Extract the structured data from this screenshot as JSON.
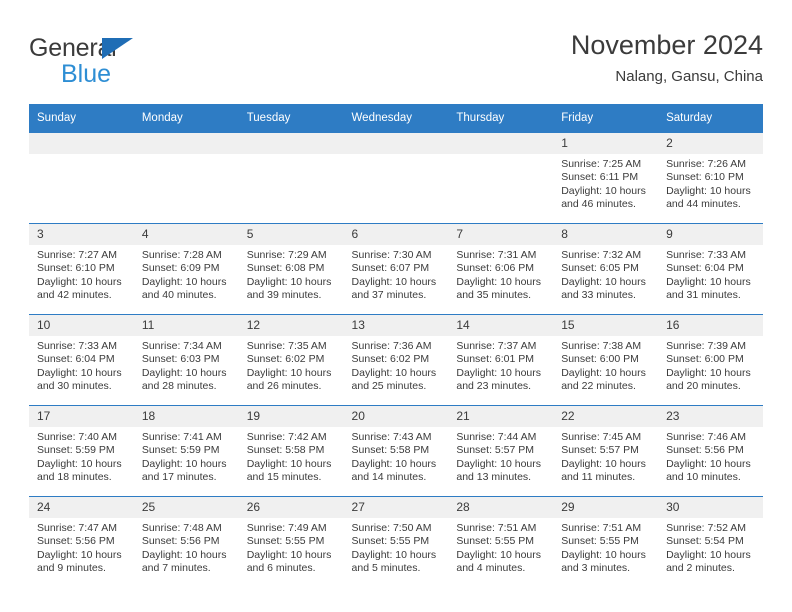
{
  "brand": {
    "name_part1": "General",
    "name_part2": "Blue",
    "triangle_color": "#1f6db5",
    "blue_text_color": "#2e8ed4"
  },
  "header": {
    "title": "November 2024",
    "subtitle": "Nalang, Gansu, China"
  },
  "theme": {
    "header_bg": "#2e7cc4",
    "daynum_bg": "#f0f0f0",
    "text_color": "#3b3b3b"
  },
  "calendar": {
    "weekday_headers": [
      "Sunday",
      "Monday",
      "Tuesday",
      "Wednesday",
      "Thursday",
      "Friday",
      "Saturday"
    ],
    "weeks": [
      [
        {
          "day": "",
          "empty": true
        },
        {
          "day": "",
          "empty": true
        },
        {
          "day": "",
          "empty": true
        },
        {
          "day": "",
          "empty": true
        },
        {
          "day": "",
          "empty": true
        },
        {
          "day": "1",
          "sunrise": "Sunrise: 7:25 AM",
          "sunset": "Sunset: 6:11 PM",
          "daylight": "Daylight: 10 hours and 46 minutes."
        },
        {
          "day": "2",
          "sunrise": "Sunrise: 7:26 AM",
          "sunset": "Sunset: 6:10 PM",
          "daylight": "Daylight: 10 hours and 44 minutes."
        }
      ],
      [
        {
          "day": "3",
          "sunrise": "Sunrise: 7:27 AM",
          "sunset": "Sunset: 6:10 PM",
          "daylight": "Daylight: 10 hours and 42 minutes."
        },
        {
          "day": "4",
          "sunrise": "Sunrise: 7:28 AM",
          "sunset": "Sunset: 6:09 PM",
          "daylight": "Daylight: 10 hours and 40 minutes."
        },
        {
          "day": "5",
          "sunrise": "Sunrise: 7:29 AM",
          "sunset": "Sunset: 6:08 PM",
          "daylight": "Daylight: 10 hours and 39 minutes."
        },
        {
          "day": "6",
          "sunrise": "Sunrise: 7:30 AM",
          "sunset": "Sunset: 6:07 PM",
          "daylight": "Daylight: 10 hours and 37 minutes."
        },
        {
          "day": "7",
          "sunrise": "Sunrise: 7:31 AM",
          "sunset": "Sunset: 6:06 PM",
          "daylight": "Daylight: 10 hours and 35 minutes."
        },
        {
          "day": "8",
          "sunrise": "Sunrise: 7:32 AM",
          "sunset": "Sunset: 6:05 PM",
          "daylight": "Daylight: 10 hours and 33 minutes."
        },
        {
          "day": "9",
          "sunrise": "Sunrise: 7:33 AM",
          "sunset": "Sunset: 6:04 PM",
          "daylight": "Daylight: 10 hours and 31 minutes."
        }
      ],
      [
        {
          "day": "10",
          "sunrise": "Sunrise: 7:33 AM",
          "sunset": "Sunset: 6:04 PM",
          "daylight": "Daylight: 10 hours and 30 minutes."
        },
        {
          "day": "11",
          "sunrise": "Sunrise: 7:34 AM",
          "sunset": "Sunset: 6:03 PM",
          "daylight": "Daylight: 10 hours and 28 minutes."
        },
        {
          "day": "12",
          "sunrise": "Sunrise: 7:35 AM",
          "sunset": "Sunset: 6:02 PM",
          "daylight": "Daylight: 10 hours and 26 minutes."
        },
        {
          "day": "13",
          "sunrise": "Sunrise: 7:36 AM",
          "sunset": "Sunset: 6:02 PM",
          "daylight": "Daylight: 10 hours and 25 minutes."
        },
        {
          "day": "14",
          "sunrise": "Sunrise: 7:37 AM",
          "sunset": "Sunset: 6:01 PM",
          "daylight": "Daylight: 10 hours and 23 minutes."
        },
        {
          "day": "15",
          "sunrise": "Sunrise: 7:38 AM",
          "sunset": "Sunset: 6:00 PM",
          "daylight": "Daylight: 10 hours and 22 minutes."
        },
        {
          "day": "16",
          "sunrise": "Sunrise: 7:39 AM",
          "sunset": "Sunset: 6:00 PM",
          "daylight": "Daylight: 10 hours and 20 minutes."
        }
      ],
      [
        {
          "day": "17",
          "sunrise": "Sunrise: 7:40 AM",
          "sunset": "Sunset: 5:59 PM",
          "daylight": "Daylight: 10 hours and 18 minutes."
        },
        {
          "day": "18",
          "sunrise": "Sunrise: 7:41 AM",
          "sunset": "Sunset: 5:59 PM",
          "daylight": "Daylight: 10 hours and 17 minutes."
        },
        {
          "day": "19",
          "sunrise": "Sunrise: 7:42 AM",
          "sunset": "Sunset: 5:58 PM",
          "daylight": "Daylight: 10 hours and 15 minutes."
        },
        {
          "day": "20",
          "sunrise": "Sunrise: 7:43 AM",
          "sunset": "Sunset: 5:58 PM",
          "daylight": "Daylight: 10 hours and 14 minutes."
        },
        {
          "day": "21",
          "sunrise": "Sunrise: 7:44 AM",
          "sunset": "Sunset: 5:57 PM",
          "daylight": "Daylight: 10 hours and 13 minutes."
        },
        {
          "day": "22",
          "sunrise": "Sunrise: 7:45 AM",
          "sunset": "Sunset: 5:57 PM",
          "daylight": "Daylight: 10 hours and 11 minutes."
        },
        {
          "day": "23",
          "sunrise": "Sunrise: 7:46 AM",
          "sunset": "Sunset: 5:56 PM",
          "daylight": "Daylight: 10 hours and 10 minutes."
        }
      ],
      [
        {
          "day": "24",
          "sunrise": "Sunrise: 7:47 AM",
          "sunset": "Sunset: 5:56 PM",
          "daylight": "Daylight: 10 hours and 9 minutes."
        },
        {
          "day": "25",
          "sunrise": "Sunrise: 7:48 AM",
          "sunset": "Sunset: 5:56 PM",
          "daylight": "Daylight: 10 hours and 7 minutes."
        },
        {
          "day": "26",
          "sunrise": "Sunrise: 7:49 AM",
          "sunset": "Sunset: 5:55 PM",
          "daylight": "Daylight: 10 hours and 6 minutes."
        },
        {
          "day": "27",
          "sunrise": "Sunrise: 7:50 AM",
          "sunset": "Sunset: 5:55 PM",
          "daylight": "Daylight: 10 hours and 5 minutes."
        },
        {
          "day": "28",
          "sunrise": "Sunrise: 7:51 AM",
          "sunset": "Sunset: 5:55 PM",
          "daylight": "Daylight: 10 hours and 4 minutes."
        },
        {
          "day": "29",
          "sunrise": "Sunrise: 7:51 AM",
          "sunset": "Sunset: 5:55 PM",
          "daylight": "Daylight: 10 hours and 3 minutes."
        },
        {
          "day": "30",
          "sunrise": "Sunrise: 7:52 AM",
          "sunset": "Sunset: 5:54 PM",
          "daylight": "Daylight: 10 hours and 2 minutes."
        }
      ]
    ]
  }
}
